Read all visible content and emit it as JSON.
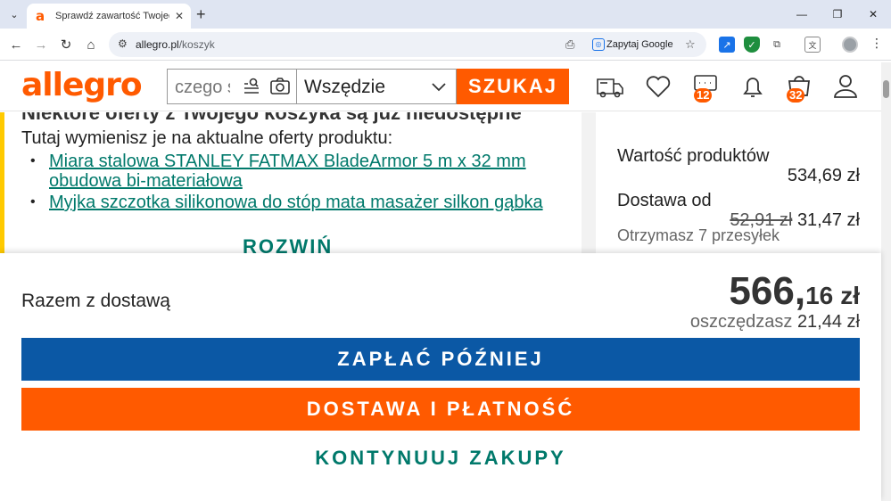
{
  "browser": {
    "tab_title": "Sprawdź zawartość Twojego koszyka",
    "url_host": "allegro.pl",
    "url_path": "/koszyk",
    "ask_google": "Zapytaj Google"
  },
  "header": {
    "logo": "allegro",
    "search_placeholder": "czego szukasz?",
    "scope_value": "Wszędzie",
    "search_button": "SZUKAJ",
    "messages_badge": "12",
    "cart_badge": "32"
  },
  "content": {
    "cut_heading": "Niektóre oferty z Twojego koszyka są już niedostępne",
    "offers_intro": "Tutaj wymienisz je na aktualne oferty produktu:",
    "offers": [
      "Miara stalowa STANLEY FATMAX BladeArmor 5 m x 32 mm obudowa bi-materiałowa",
      "Myjka szczotka silikonowa do stóp mata masażer silkon gąbka"
    ],
    "expand": "ROZWIŃ"
  },
  "summary": {
    "products_label": "Wartość produktów",
    "products_value": "534,69 zł",
    "delivery_label": "Dostawa od",
    "delivery_old": "52,91 zł",
    "delivery_new": "31,47 zł",
    "shipments_note": "Otrzymasz 7 przesyłek"
  },
  "total": {
    "label": "Razem z dostawą",
    "amount_int": "566,",
    "amount_dec": "16",
    "currency": "zł",
    "savings_label": "oszczędzasz",
    "savings_value": "21,44 zł"
  },
  "actions": {
    "pay_later": "ZAPŁAĆ PÓŹNIEJ",
    "checkout": "DOSTAWA I PŁATNOŚĆ",
    "continue": "KONTYNUUJ ZAKUPY"
  },
  "colors": {
    "brand_orange": "#ff5a00",
    "pay_later_blue": "#0b58a5",
    "link_teal": "#00796b"
  }
}
